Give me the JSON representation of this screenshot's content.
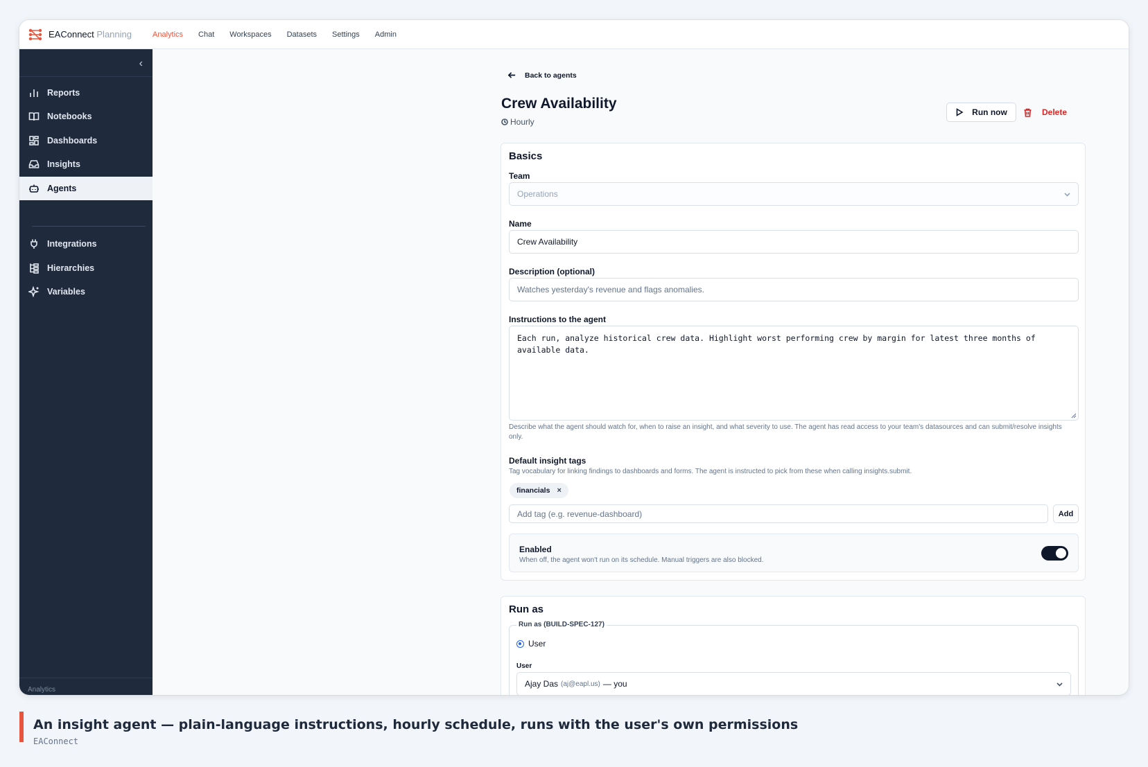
{
  "app": {
    "brand": "EAConnect",
    "brand_sub": "Planning",
    "top_nav": [
      "Analytics",
      "Chat",
      "Workspaces",
      "Datasets",
      "Settings",
      "Admin"
    ],
    "active_top_nav": "Analytics",
    "accent_color": "#e8553e"
  },
  "sidebar": {
    "items": [
      {
        "label": "Reports",
        "icon": "bar-chart-icon"
      },
      {
        "label": "Notebooks",
        "icon": "book-open-icon"
      },
      {
        "label": "Dashboards",
        "icon": "layout-dashboard-icon"
      },
      {
        "label": "Insights",
        "icon": "inbox-icon"
      },
      {
        "label": "Agents",
        "icon": "bot-icon",
        "active": true
      },
      {
        "label": "Integrations",
        "icon": "plug-icon"
      },
      {
        "label": "Hierarchies",
        "icon": "tree-icon"
      },
      {
        "label": "Variables",
        "icon": "sparkles-icon"
      }
    ],
    "footer": "Analytics"
  },
  "page": {
    "back_label": "Back to agents",
    "title": "Crew Availability",
    "schedule": "Hourly",
    "run_now_label": "Run now",
    "delete_label": "Delete"
  },
  "basics": {
    "heading": "Basics",
    "team_label": "Team",
    "team_value": "Operations",
    "name_label": "Name",
    "name_value": "Crew Availability",
    "description_label": "Description (optional)",
    "description_placeholder": "Watches yesterday's revenue and flags anomalies.",
    "instructions_label": "Instructions to the agent",
    "instructions_value": "Each run, analyze historical crew data. Highlight worst performing crew by margin for latest three months of available data.",
    "instructions_help": "Describe what the agent should watch for, when to raise an insight, and what severity to use. The agent has read access to your team's datasources and can submit/resolve insights only.",
    "tags_label": "Default insight tags",
    "tags_help": "Tag vocabulary for linking findings to dashboards and forms. The agent is instructed to pick from these when calling insights.submit.",
    "tags": [
      "financials"
    ],
    "add_tag_placeholder": "Add tag (e.g. revenue-dashboard)",
    "add_tag_button": "Add",
    "enabled_title": "Enabled",
    "enabled_desc": "When off, the agent won't run on its schedule. Manual triggers are also blocked.",
    "enabled": true
  },
  "run_as": {
    "heading": "Run as",
    "legend": "Run as (BUILD-SPEC-127)",
    "radio_option": "User",
    "user_label": "User",
    "user_name": "Ajay Das",
    "user_email": "(aj@eapl.us)",
    "user_suffix": "— you"
  },
  "caption": {
    "title": "An insight agent — plain-language instructions, hourly schedule, runs with the user's own permissions",
    "source": "EAConnect"
  }
}
